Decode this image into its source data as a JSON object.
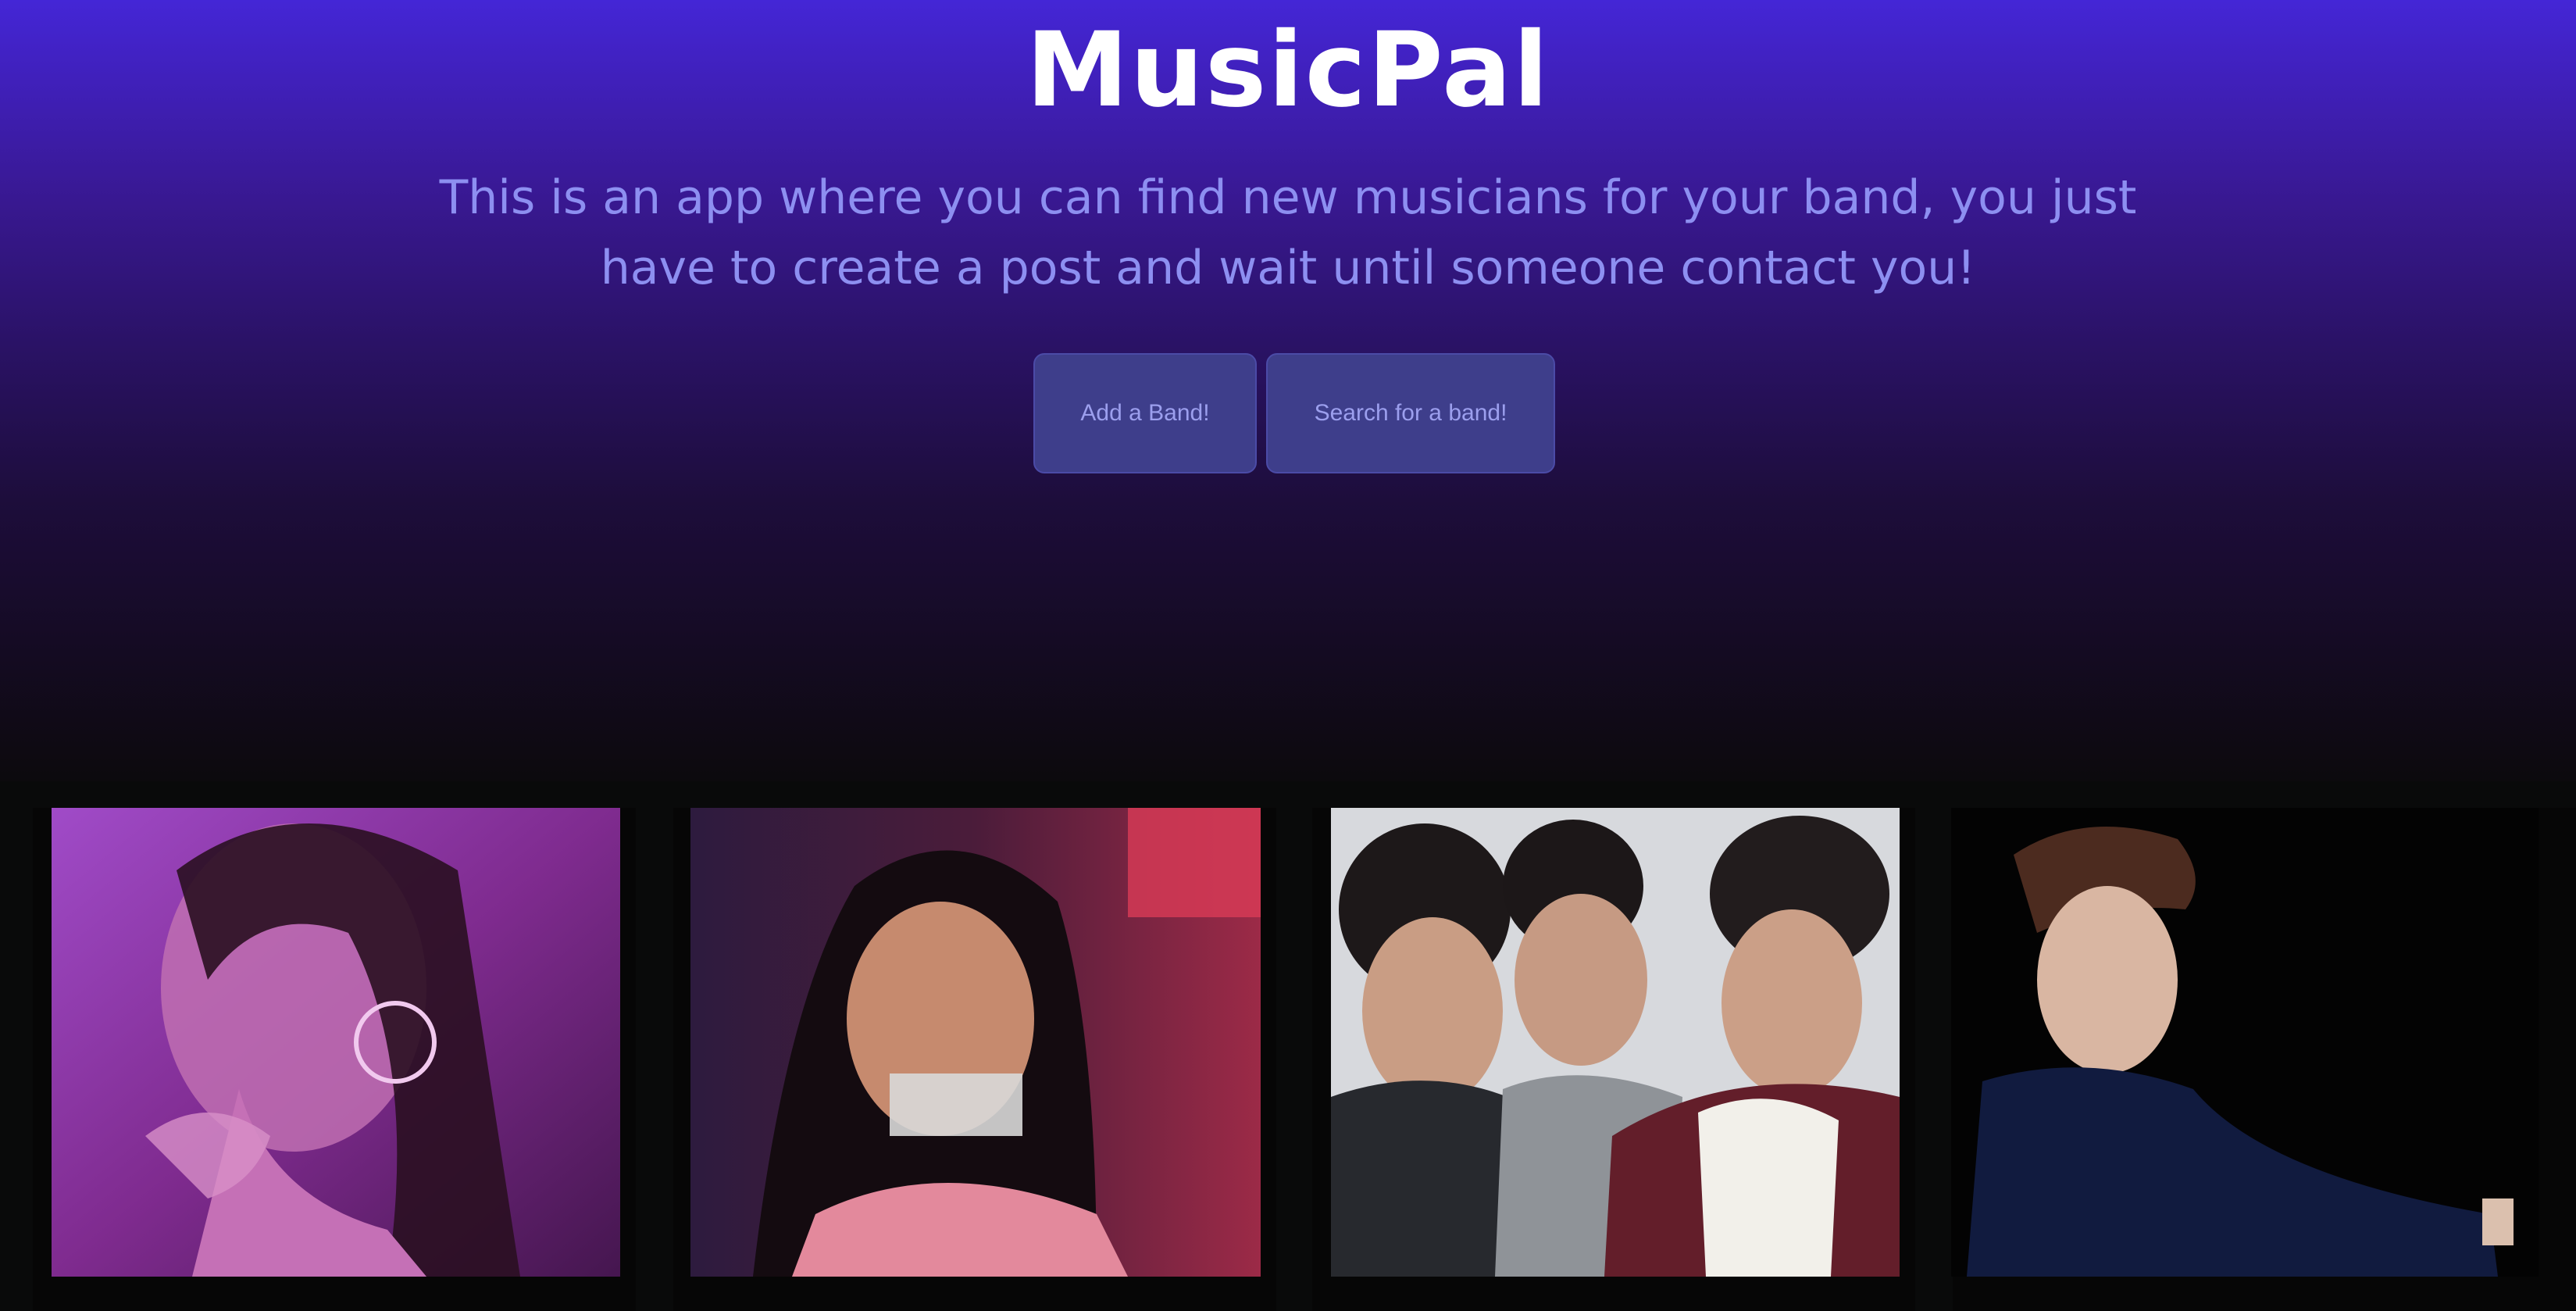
{
  "hero": {
    "title": "MusicPal",
    "subtitle": "This is an app where you can find new musicians for your band, you just have to create a post and wait until someone contact you!"
  },
  "actions": {
    "add_band_label": "Add a Band!",
    "search_band_label": "Search for a band!"
  },
  "cards": [
    {
      "image": "artist-photo-pink-lighting"
    },
    {
      "image": "artist-photo-pink-dress-stage"
    },
    {
      "image": "band-photo-three-men"
    },
    {
      "image": "artist-photo-blue-shirt"
    }
  ],
  "colors": {
    "hero_top": "#4426d6",
    "hero_bottom": "#0c0a0d",
    "subtitle_text": "#8d8ff1",
    "button_bg": "#3e3e8b",
    "button_text": "#9c9fee"
  }
}
